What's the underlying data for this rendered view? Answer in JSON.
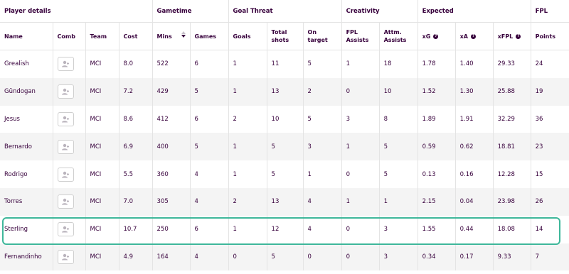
{
  "groups": [
    {
      "label": "Player details"
    },
    {
      "label": "Gametime"
    },
    {
      "label": "Goal Threat"
    },
    {
      "label": "Creativity"
    },
    {
      "label": "Expected"
    },
    {
      "label": "FPL"
    }
  ],
  "columns": {
    "name": "Name",
    "comb": "Comb",
    "team": "Team",
    "cost": "Cost",
    "mins": "Mins",
    "games": "Games",
    "goals": "Goals",
    "total_shots_1": "Total",
    "total_shots_2": "shots",
    "on_target_1": "On",
    "on_target_2": "target",
    "fpl_assists_1": "FPL",
    "fpl_assists_2": "Assists",
    "attm_assists_1": "Attm.",
    "attm_assists_2": "Assists",
    "xg": "xG",
    "xa": "xA",
    "xfpl": "xFPL",
    "points": "Points"
  },
  "help_glyph": "?",
  "colors": {
    "accent": "#3eb79a",
    "text": "#37003c"
  },
  "rows": [
    {
      "name": "Grealish",
      "team": "MCI",
      "cost": "8.0",
      "mins": "522",
      "games": "6",
      "goals": "1",
      "shots": "11",
      "on_target": "5",
      "fpl_assists": "1",
      "attm_assists": "18",
      "xg": "1.78",
      "xa": "1.40",
      "xfpl": "29.33",
      "points": "24"
    },
    {
      "name": "Gündogan",
      "team": "MCI",
      "cost": "7.2",
      "mins": "429",
      "games": "5",
      "goals": "1",
      "shots": "13",
      "on_target": "2",
      "fpl_assists": "0",
      "attm_assists": "10",
      "xg": "1.52",
      "xa": "1.30",
      "xfpl": "25.88",
      "points": "19"
    },
    {
      "name": "Jesus",
      "team": "MCI",
      "cost": "8.6",
      "mins": "412",
      "games": "6",
      "goals": "2",
      "shots": "10",
      "on_target": "5",
      "fpl_assists": "3",
      "attm_assists": "8",
      "xg": "1.89",
      "xa": "1.91",
      "xfpl": "32.29",
      "points": "36"
    },
    {
      "name": "Bernardo",
      "team": "MCI",
      "cost": "6.9",
      "mins": "400",
      "games": "5",
      "goals": "1",
      "shots": "5",
      "on_target": "3",
      "fpl_assists": "1",
      "attm_assists": "5",
      "xg": "0.59",
      "xa": "0.62",
      "xfpl": "18.81",
      "points": "23"
    },
    {
      "name": "Rodrigo",
      "team": "MCI",
      "cost": "5.5",
      "mins": "360",
      "games": "4",
      "goals": "1",
      "shots": "5",
      "on_target": "1",
      "fpl_assists": "0",
      "attm_assists": "5",
      "xg": "0.13",
      "xa": "0.16",
      "xfpl": "12.28",
      "points": "15"
    },
    {
      "name": "Torres",
      "team": "MCI",
      "cost": "7.0",
      "mins": "305",
      "games": "4",
      "goals": "2",
      "shots": "13",
      "on_target": "4",
      "fpl_assists": "1",
      "attm_assists": "1",
      "xg": "2.15",
      "xa": "0.04",
      "xfpl": "23.98",
      "points": "26"
    },
    {
      "name": "Sterling",
      "team": "MCI",
      "cost": "10.7",
      "mins": "250",
      "games": "6",
      "goals": "1",
      "shots": "12",
      "on_target": "4",
      "fpl_assists": "0",
      "attm_assists": "3",
      "xg": "1.55",
      "xa": "0.44",
      "xfpl": "18.08",
      "points": "14"
    },
    {
      "name": "Fernandinho",
      "team": "MCI",
      "cost": "4.9",
      "mins": "164",
      "games": "4",
      "goals": "0",
      "shots": "5",
      "on_target": "0",
      "fpl_assists": "0",
      "attm_assists": "3",
      "xg": "0.34",
      "xa": "0.17",
      "xfpl": "9.33",
      "points": "7"
    }
  ],
  "highlighted_row": "Sterling",
  "comb_icon": "add-player-icon"
}
